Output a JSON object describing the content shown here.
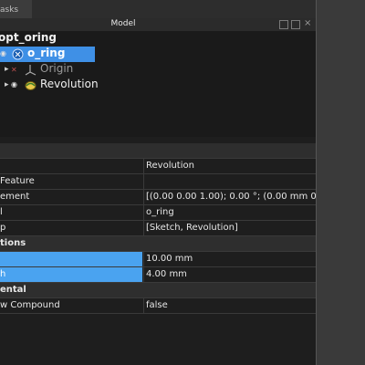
{
  "tabs": {
    "tasks_label": "asks"
  },
  "model_panel": {
    "title": "Model"
  },
  "tree": {
    "root_label": "opt_oring",
    "items": [
      {
        "label": "o_ring",
        "selected": true
      },
      {
        "label": "Origin",
        "dimmed": true
      },
      {
        "label": "Revolution"
      }
    ]
  },
  "properties": {
    "header_value": "Revolution",
    "rows": [
      {
        "name": "Feature",
        "value": ""
      },
      {
        "name": "ement",
        "value": "[(0.00 0.00 1.00); 0.00 °; (0.00 mm  0.00 mm..."
      },
      {
        "name": "l",
        "value": "o_ring"
      },
      {
        "name": "p",
        "value": "[Sketch, Revolution]"
      },
      {
        "group": "tions"
      },
      {
        "name": "",
        "value": "10.00 mm",
        "highlight": true
      },
      {
        "name": "h",
        "value": "4.00 mm",
        "highlight": true
      },
      {
        "group": "ental"
      },
      {
        "name": "w Compound",
        "value": "false"
      }
    ]
  },
  "colors": {
    "accent": "#3f90e6",
    "panel_bg": "#1e1e1e"
  }
}
